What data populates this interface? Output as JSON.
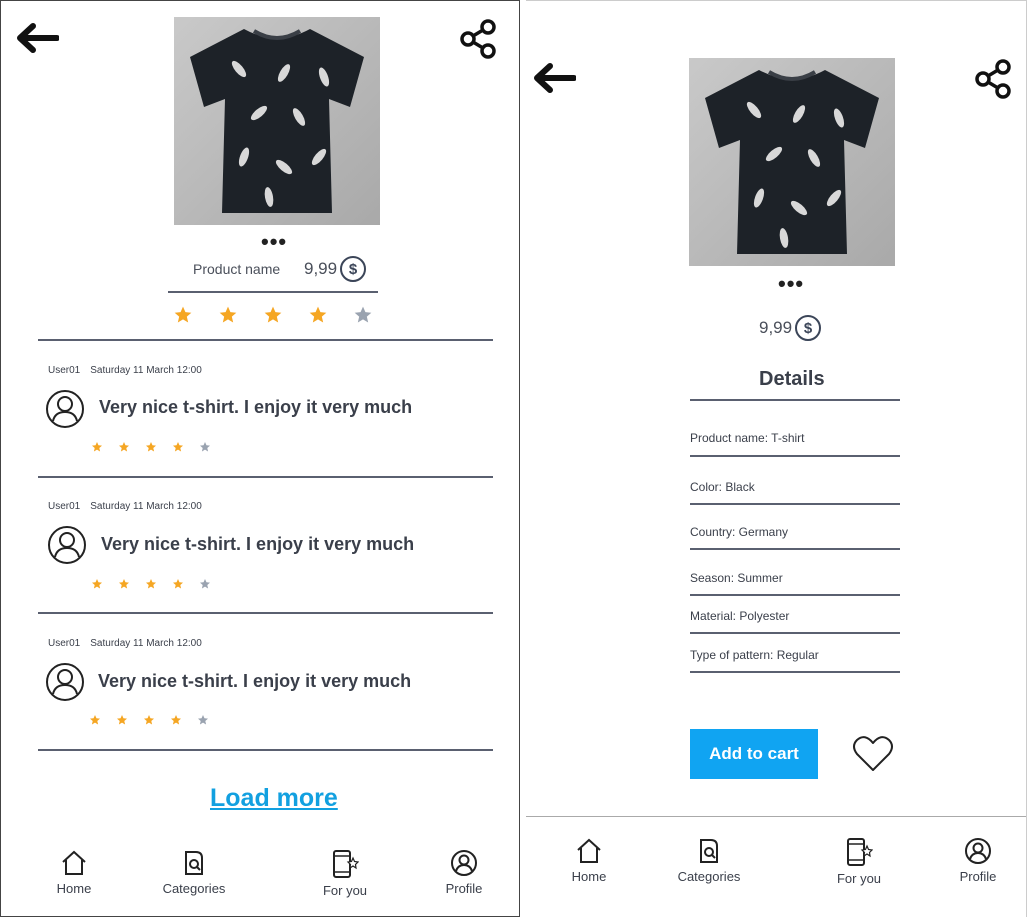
{
  "left": {
    "product_name": "Product name",
    "price": "9,99",
    "currency_symbol": "$",
    "rating": 4,
    "rating_max": 5,
    "dots": "•••",
    "reviews": [
      {
        "user": "User01",
        "date": "Saturday 11 March 12:00",
        "text": "Very nice t-shirt. I enjoy it very much",
        "rating": 4
      },
      {
        "user": "User01",
        "date": "Saturday 11 March 12:00",
        "text": "Very nice t-shirt. I enjoy it very much",
        "rating": 4
      },
      {
        "user": "User01",
        "date": "Saturday 11 March 12:00",
        "text": "Very nice t-shirt. I enjoy it very much",
        "rating": 4
      }
    ],
    "load_more": "Load more"
  },
  "right": {
    "price": "9,99",
    "currency_symbol": "$",
    "dots": "•••",
    "details_title": "Details",
    "details": [
      "Product name: T-shirt",
      "Color: Black",
      "Country: Germany",
      "Season: Summer",
      "Material: Polyester",
      "Type of pattern: Regular"
    ],
    "add_to_cart": "Add to cart"
  },
  "nav": {
    "home": "Home",
    "categories": "Categories",
    "for_you": "For you",
    "profile": "Profile"
  },
  "colors": {
    "star_filled": "#f5a623",
    "star_empty": "#9aa3b0",
    "accent": "#10a4f2",
    "link": "#12a0e0",
    "divider": "#5a6070"
  }
}
